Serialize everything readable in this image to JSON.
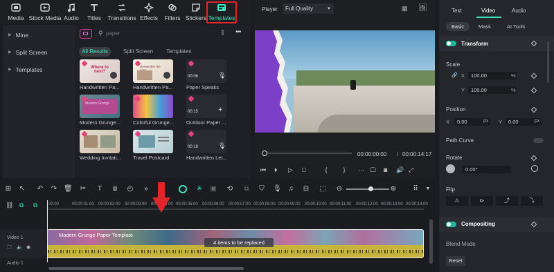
{
  "toolbar": {
    "items": [
      {
        "label": "Media",
        "icon": "media-icon"
      },
      {
        "label": "Stock Media",
        "icon": "stock-media-icon"
      },
      {
        "label": "Audio",
        "icon": "audio-icon"
      },
      {
        "label": "Titles",
        "icon": "titles-icon"
      },
      {
        "label": "Transitions",
        "icon": "transitions-icon"
      },
      {
        "label": "Effects",
        "icon": "effects-icon"
      },
      {
        "label": "Filters",
        "icon": "filters-icon"
      },
      {
        "label": "Stickers",
        "icon": "stickers-icon"
      },
      {
        "label": "Templates",
        "icon": "templates-icon"
      }
    ],
    "active": "Templates",
    "highlight_color": "#e0262a",
    "accent_color": "#3ee6c0"
  },
  "sidebar": {
    "items": [
      {
        "label": "Mine"
      },
      {
        "label": "Split Screen"
      },
      {
        "label": "Templates"
      }
    ]
  },
  "templates_panel": {
    "search_placeholder": "paper",
    "tabs": [
      "All Results",
      "Split Screen",
      "Templates"
    ],
    "active_tab": "All Results",
    "items": [
      {
        "label": "Handwritten Pa...",
        "duration": ""
      },
      {
        "label": "Handwritten Pa...",
        "duration": ""
      },
      {
        "label": "Paper Speaks",
        "duration": "00:06"
      },
      {
        "label": "Modern Grunge...",
        "duration": ""
      },
      {
        "label": "Colorful Grunge...",
        "duration": ""
      },
      {
        "label": "Outdoor Paper ...",
        "duration": "00:15"
      },
      {
        "label": "Wedding Invitati...",
        "duration": ""
      },
      {
        "label": "Travel Postcard",
        "duration": ""
      },
      {
        "label": "Handwritten Let...",
        "duration": "00:18"
      }
    ],
    "thumb_texts": [
      "Where to next?",
      "Remember the days",
      "Modern Grunge"
    ]
  },
  "player": {
    "label": "Player",
    "quality": "Full Quality",
    "current_time": "00:00:00:00",
    "separator": "/",
    "total_time": "00:00:14:17",
    "progress": 0.0
  },
  "inspector": {
    "top_tabs": [
      "Text",
      "Video",
      "Audio"
    ],
    "active_top_tab": "Video",
    "sub_tabs": [
      "Basic",
      "Mask",
      "AI Tools"
    ],
    "active_sub_tab": "Basic",
    "transform": {
      "title": "Transform",
      "scale_label": "Scale",
      "x_label": "X",
      "y_label": "Y",
      "scale_x": "100.00",
      "scale_y": "100.00",
      "unit_percent": "%",
      "position_label": "Position",
      "pos_x": "0.00",
      "pos_y": "0.00",
      "unit_px": "px",
      "path_curve_label": "Path Curve",
      "rotate_label": "Rotate",
      "rotate_value": "0.00°",
      "flip_label": "Flip"
    },
    "compositing": {
      "title": "Compositing",
      "blend_mode_label": "Blend Mode"
    },
    "reset_label": "Reset"
  },
  "timeline": {
    "timecodes": [
      "00:00",
      "00:00:01:00",
      "00:00:02:00",
      "00:00:03:00",
      "00:00:04:00",
      "00:00:05:00",
      "00:00:06:00",
      "00:00:07:00",
      "00:00:08:00",
      "00:00:09:00",
      "00:00:10:00",
      "00:00:11:00",
      "00:00:12:00",
      "00:00:13:00",
      "00:00:14:00"
    ],
    "video_track_label": "Video 1",
    "audio_track_label": "Audio 1",
    "clip_title": "Modern Grunge Paper Template",
    "replace_badge": "4 items to be replaced",
    "arrow_color": "#e0262a"
  }
}
